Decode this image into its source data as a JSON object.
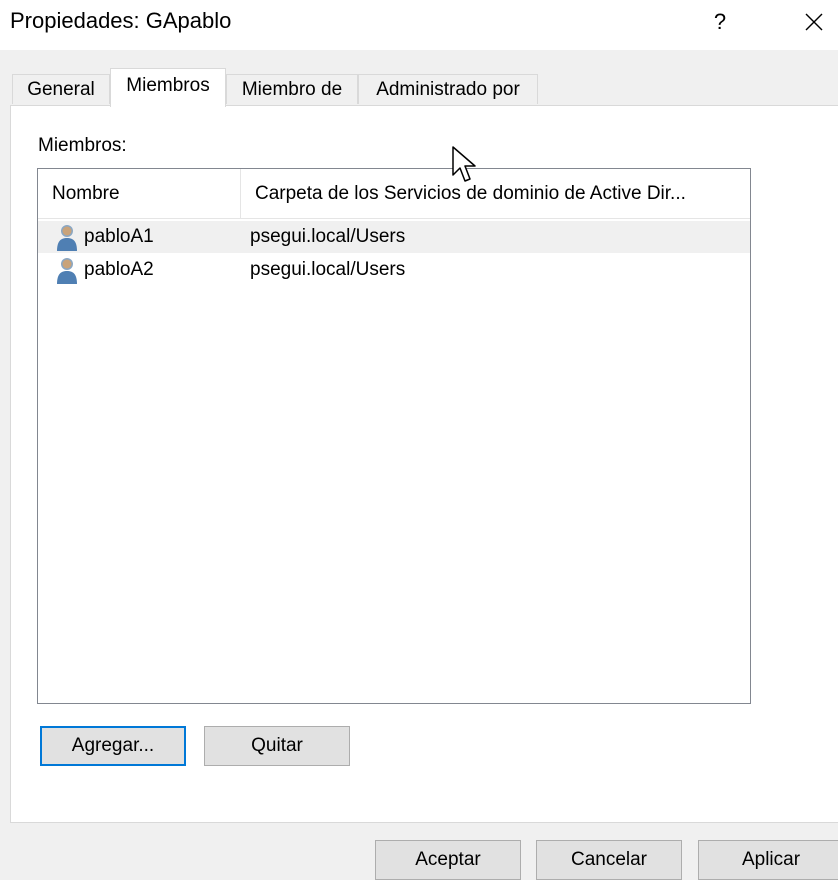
{
  "window": {
    "title": "Propiedades: GApablo",
    "help_label": "?",
    "close_icon": "close-icon"
  },
  "tabs": [
    {
      "label": "General",
      "active": false
    },
    {
      "label": "Miembros",
      "active": true
    },
    {
      "label": "Miembro de",
      "active": false
    },
    {
      "label": "Administrado por",
      "active": false
    }
  ],
  "members": {
    "label": "Miembros:",
    "columns": [
      "Nombre",
      "Carpeta de los Servicios de dominio de Active Dir..."
    ],
    "rows": [
      {
        "name": "pabloA1",
        "folder": "psegui.local/Users",
        "icon": "user-icon",
        "selected": true
      },
      {
        "name": "pabloA2",
        "folder": "psegui.local/Users",
        "icon": "user-icon",
        "selected": false
      }
    ]
  },
  "buttons": {
    "add": "Agregar...",
    "remove": "Quitar",
    "ok": "Aceptar",
    "cancel": "Cancelar",
    "apply": "Aplicar"
  },
  "colors": {
    "focus_border": "#0078d7",
    "button_bg": "#e1e1e1",
    "selected_row": "#f0f0f0"
  }
}
